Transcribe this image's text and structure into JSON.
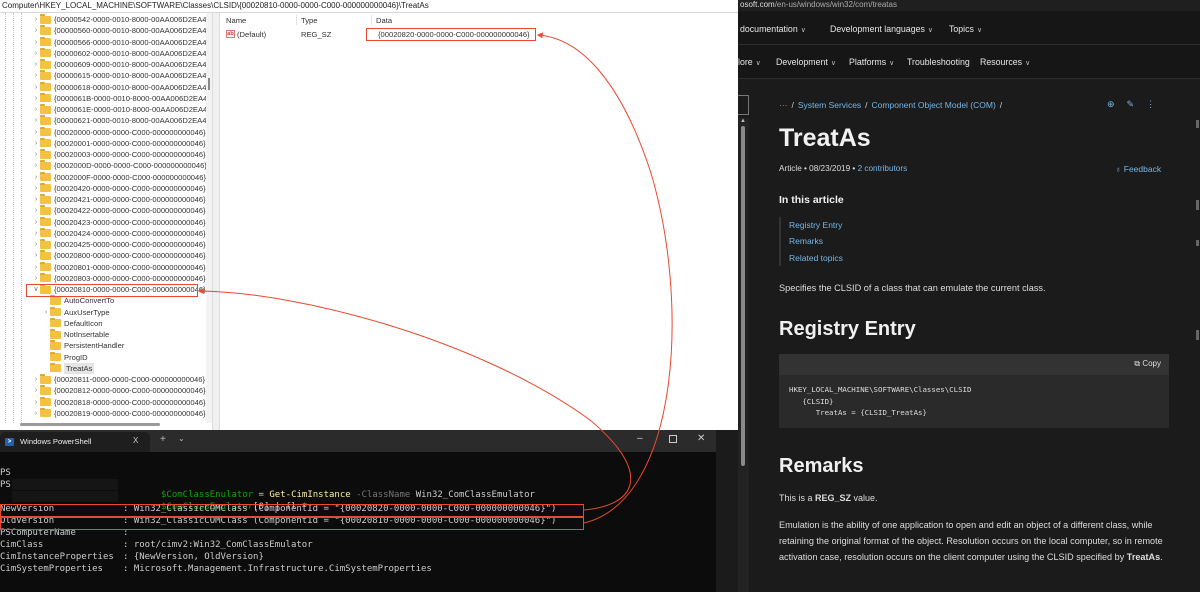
{
  "regedit": {
    "address": "Computer\\HKEY_LOCAL_MACHINE\\SOFTWARE\\Classes\\CLSID\\{00020810-0000-0000-C000-000000000046}\\TreatAs",
    "tree_items": [
      {
        "label": "{00000542-0000-0010-8000-00AA006D2EA4}",
        "level": 0,
        "expandable": true
      },
      {
        "label": "{00000560-0000-0010-8000-00AA006D2EA4}",
        "level": 0,
        "expandable": true
      },
      {
        "label": "{00000566-0000-0010-8000-00AA006D2EA4}",
        "level": 0,
        "expandable": true
      },
      {
        "label": "{00000602-0000-0010-8000-00AA006D2EA4}",
        "level": 0,
        "expandable": true
      },
      {
        "label": "{00000609-0000-0010-8000-00AA006D2EA4}",
        "level": 0,
        "expandable": true
      },
      {
        "label": "{00000615-0000-0010-8000-00AA006D2EA4}",
        "level": 0,
        "expandable": true
      },
      {
        "label": "{00000618-0000-0010-8000-00AA006D2EA4}",
        "level": 0,
        "expandable": true
      },
      {
        "label": "{0000061B-0000-0010-8000-00AA006D2EA4}",
        "level": 0,
        "expandable": true
      },
      {
        "label": "{0000061E-0000-0010-8000-00AA006D2EA4}",
        "level": 0,
        "expandable": true
      },
      {
        "label": "{00000621-0000-0010-8000-00AA006D2EA4}",
        "level": 0,
        "expandable": true
      },
      {
        "label": "{00020000-0000-0000-C000-000000000046}",
        "level": 0,
        "expandable": true
      },
      {
        "label": "{00020001-0000-0000-C000-000000000046}",
        "level": 0,
        "expandable": true
      },
      {
        "label": "{00020003-0000-0000-C000-000000000046}",
        "level": 0,
        "expandable": true
      },
      {
        "label": "{0002000D-0000-0000-C000-000000000046}",
        "level": 0,
        "expandable": true
      },
      {
        "label": "{0002000F-0000-0000-C000-000000000046}",
        "level": 0,
        "expandable": true
      },
      {
        "label": "{00020420-0000-0000-C000-000000000046}",
        "level": 0,
        "expandable": true
      },
      {
        "label": "{00020421-0000-0000-C000-000000000046}",
        "level": 0,
        "expandable": true
      },
      {
        "label": "{00020422-0000-0000-C000-000000000046}",
        "level": 0,
        "expandable": true
      },
      {
        "label": "{00020423-0000-0000-C000-000000000046}",
        "level": 0,
        "expandable": true
      },
      {
        "label": "{00020424-0000-0000-C000-000000000046}",
        "level": 0,
        "expandable": true
      },
      {
        "label": "{00020425-0000-0000-C000-000000000046}",
        "level": 0,
        "expandable": true
      },
      {
        "label": "{00020800-0000-0000-C000-000000000046}",
        "level": 0,
        "expandable": true
      },
      {
        "label": "{00020801-0000-0000-C000-000000000046}",
        "level": 0,
        "expandable": true
      },
      {
        "label": "{00020803-0000-0000-C000-000000000046}",
        "level": 0,
        "expandable": true
      },
      {
        "label": "{00020810-0000-0000-C000-000000000046}",
        "level": 0,
        "expandable": true,
        "expanded": true,
        "highlighted": true
      },
      {
        "label": "AutoConvertTo",
        "level": 1,
        "expandable": false
      },
      {
        "label": "AuxUserType",
        "level": 1,
        "expandable": true
      },
      {
        "label": "DefaultIcon",
        "level": 1,
        "expandable": false
      },
      {
        "label": "NotInsertable",
        "level": 1,
        "expandable": false
      },
      {
        "label": "PersistentHandler",
        "level": 1,
        "expandable": false
      },
      {
        "label": "ProgID",
        "level": 1,
        "expandable": false
      },
      {
        "label": "TreatAs",
        "level": 1,
        "expandable": false,
        "selected": true
      },
      {
        "label": "{00020811-0000-0000-C000-000000000046}",
        "level": 0,
        "expandable": true
      },
      {
        "label": "{00020812-0000-0000-C000-000000000046}",
        "level": 0,
        "expandable": true
      },
      {
        "label": "{00020818-0000-0000-C000-000000000046}",
        "level": 0,
        "expandable": true
      },
      {
        "label": "{00020819-0000-0000-C000-000000000046}",
        "level": 0,
        "expandable": true
      }
    ],
    "values": {
      "columns": [
        "Name",
        "Type",
        "Data"
      ],
      "rows": [
        {
          "icon": "ab",
          "name": "(Default)",
          "type": "REG_SZ",
          "data": "{00020820-0000-0000-C000-000000000046}"
        }
      ]
    }
  },
  "powershell": {
    "tab_title": "Windows PowerShell",
    "tab_close": "X",
    "new_tab": "+",
    "dropdown": "⌄",
    "window_controls": {
      "minimize": "–",
      "close": "✕"
    },
    "prompt": "PS",
    "command1": {
      "var": "$ComClassEnulator",
      "eq": " = ",
      "cmd": "Get-CimInstance",
      "param": " -ClassName ",
      "arg": "Win32_ComClassEmulator"
    },
    "command2": {
      "var": "$ComClassEnulator",
      "rest": "[0] | fl *"
    },
    "output": [
      {
        "prop": "NewVersion",
        "value": ": Win32_ClassicCOMClass (ComponentId = \"{00020820-0000-0000-C000-000000000046}\")",
        "highlighted": true
      },
      {
        "prop": "OldVersion",
        "value": ": Win32_ClassicCOMClass (ComponentId = \"{00020810-0000-0000-C000-000000000046}\")",
        "highlighted": true
      },
      {
        "prop": "PSComputerName",
        "value": ":"
      },
      {
        "prop": "CimClass",
        "value": ": root/cimv2:Win32_ComClassEmulator"
      },
      {
        "prop": "CimInstanceProperties",
        "value": ": {NewVersion, OldVersion}"
      },
      {
        "prop": "CimSystemProperties",
        "value": ": Microsoft.Management.Infrastructure.CimSystemProperties"
      }
    ]
  },
  "web": {
    "url_host": "osoft.com",
    "url_path": "/en-us/windows/win32/com/treatas",
    "nav_primary": [
      {
        "label": "documentation"
      },
      {
        "label": "Development languages"
      },
      {
        "label": "Topics"
      }
    ],
    "nav_secondary": [
      {
        "label": "lore"
      },
      {
        "label": "Development"
      },
      {
        "label": "Platforms"
      },
      {
        "label": "Troubleshooting",
        "no_chevron": true
      },
      {
        "label": "Resources"
      }
    ],
    "breadcrumb": {
      "ellipsis": "···",
      "items": [
        "System Services",
        "Component Object Model (COM)"
      ]
    },
    "title": "TreatAs",
    "meta": {
      "type": "Article",
      "date": "08/23/2019",
      "contributors": "2 contributors"
    },
    "feedback_label": "Feedback",
    "toc_heading": "In this article",
    "toc": [
      "Registry Entry",
      "Remarks",
      "Related topics"
    ],
    "intro": "Specifies the CLSID of a class that can emulate the current class.",
    "registry_heading": "Registry Entry",
    "copy_label": "Copy",
    "code": "HKEY_LOCAL_MACHINE\\SOFTWARE\\Classes\\CLSID\n   {CLSID}\n      TreatAs = {CLSID_TreatAs}",
    "remarks_heading": "Remarks",
    "remarks_p1_prefix": "This is a ",
    "remarks_p1_bold": "REG_SZ",
    "remarks_p1_suffix": " value.",
    "remarks_p2_text": "Emulation is the ability of one application to open and edit an object of a different class, while retaining the original format of the object. Resolution occurs on the local computer, so in remote activation case, resolution occurs on the client computer using the CLSID specified by ",
    "remarks_p2_bold": "TreatAs",
    "remarks_p2_end": "."
  },
  "annotation": {
    "color": "#e8492f"
  }
}
